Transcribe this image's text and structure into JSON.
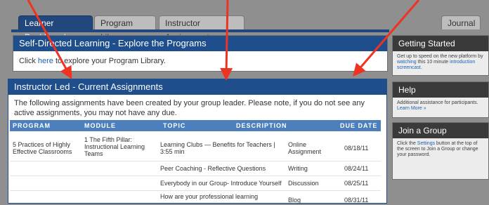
{
  "tabs": [
    {
      "label": "Learner Dashboard",
      "active": true
    },
    {
      "label": "Program Library",
      "active": false
    },
    {
      "label": "Instructor Assignments",
      "active": false
    },
    {
      "label": "Journal",
      "active": false
    }
  ],
  "self_directed": {
    "title": "Self-Directed Learning - Explore the Programs",
    "body_prefix": "Click ",
    "link": "here",
    "body_suffix": " to explore your Program Library."
  },
  "instructor_led": {
    "title": "Instructor Led - Current Assignments",
    "intro": "The following assignments have been created by your group leader. Please note, if you do not see any active assignments, you may not have any due.",
    "columns": [
      "PROGRAM",
      "MODULE",
      "TOPIC",
      "DESCRIPTION",
      "DUE DATE"
    ],
    "rows": [
      {
        "program": "5 Practices of Highly Effective Classrooms",
        "module": "1 The Fifth Pillar: Instructional Learning Teams",
        "topic": "Learning Clubs — Benefits for Teachers | 3:55 min",
        "description": "Online Assignment",
        "due": "08/18/11"
      },
      {
        "program": "",
        "module": "",
        "topic": "Peer Coaching - Reflective Questions",
        "description": "Writing",
        "due": "08/24/11"
      },
      {
        "program": "",
        "module": "",
        "topic": "Everybody in our Group- Introduce Yourself",
        "description": "Discussion",
        "due": "08/25/11"
      },
      {
        "program": "",
        "module": "",
        "topic": "How are your professional learning",
        "description": "Blog",
        "due": "08/31/11"
      }
    ]
  },
  "sidebar": {
    "getting_started": {
      "title": "Getting Started",
      "text1": "Get up to speed on the new platform by ",
      "link1": "watching",
      "text2": " this 10 minute ",
      "link2": "introduction screencast",
      "text3": "."
    },
    "help": {
      "title": "Help",
      "text": "Additional assistance for participants. ",
      "link": "Learn More »"
    },
    "join_group": {
      "title": "Join a Group",
      "text1": "Click the ",
      "link": "Settings",
      "text2": " button at the top of the screen to Join a Group or change your password."
    }
  },
  "colors": {
    "accent": "#1f4e8c",
    "arrow": "#ee3322",
    "sidebar_head": "#3a3a3a"
  }
}
